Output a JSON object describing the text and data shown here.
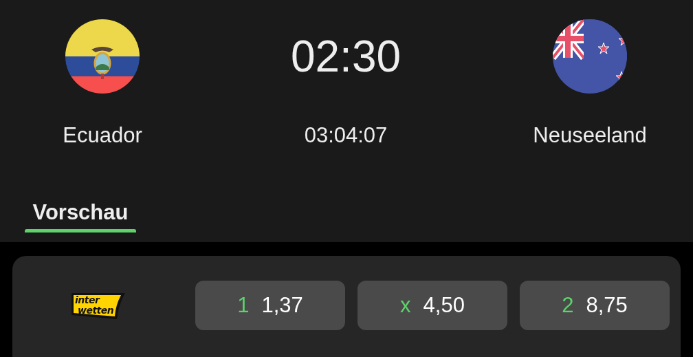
{
  "match": {
    "home": {
      "name": "Ecuador",
      "kind": "ecuador"
    },
    "time": "02:30",
    "countdown": "03:04:07",
    "away": {
      "name": "Neuseeland",
      "kind": "new-zealand"
    }
  },
  "tabs": [
    {
      "label": "Vorschau",
      "selected": true
    }
  ],
  "bookmakers": [
    {
      "logo": [
        "inter",
        "wetten"
      ],
      "odds": [
        {
          "label": "1",
          "value": "1,37"
        },
        {
          "label": "x",
          "value": "4,50"
        },
        {
          "label": "2",
          "value": "8,75"
        }
      ]
    }
  ]
}
